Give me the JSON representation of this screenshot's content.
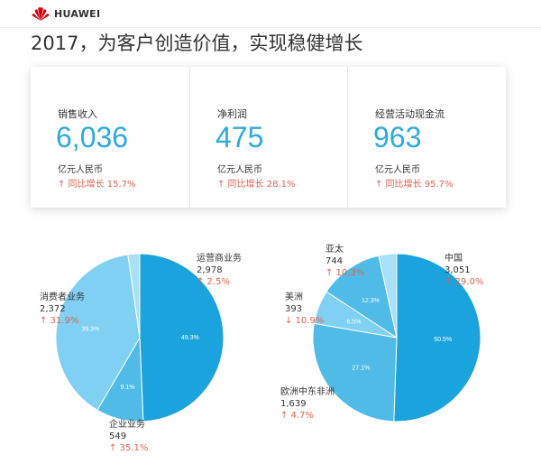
{
  "header": {
    "brand": "HUAWEI",
    "headline": "2017，为客户创造价值，实现稳健增长"
  },
  "kpis": [
    {
      "label": "销售收入",
      "value": "6,036",
      "unit": "亿元人民币",
      "change": "↑ 同比增长 15.7%"
    },
    {
      "label": "净利润",
      "value": "475",
      "unit": "亿元人民币",
      "change": "↑ 同比增长 28.1%"
    },
    {
      "label": "经营活动现金流",
      "value": "963",
      "unit": "亿元人民币",
      "change": "↑ 同比增长 95.7%"
    }
  ],
  "colors": {
    "accent": "#2eaadc",
    "up": "#e2604f",
    "pie_dark": "#1aa3dc",
    "pie_mid": "#4fbbe6",
    "pie_light": "#7fd0f2",
    "pie_lighter": "#a8e0f7"
  },
  "chart_data": [
    {
      "type": "pie",
      "title": "",
      "slices": [
        {
          "name": "运营商业务",
          "value": 2978,
          "percent": 49.3,
          "label": "49.3%",
          "change": "↑ 2.5%"
        },
        {
          "name": "企业业务",
          "value": 549,
          "percent": 9.1,
          "label": "9.1%",
          "change": "↑ 35.1%"
        },
        {
          "name": "消费者业务",
          "value": 2372,
          "percent": 39.3,
          "label": "39.3%",
          "change": "↑ 31.9%"
        },
        {
          "name": "",
          "value": 137,
          "percent": 2.3,
          "label": "",
          "change": ""
        }
      ],
      "callouts": [
        {
          "name": "运营商业务",
          "value": "2,978",
          "change": "↑ 2.5%"
        },
        {
          "name": "消费者业务",
          "value": "2,372",
          "change": "↑ 31.9%"
        },
        {
          "name": "企业业务",
          "value": "549",
          "change": "↑ 35.1%"
        }
      ]
    },
    {
      "type": "pie",
      "title": "",
      "slices": [
        {
          "name": "中国",
          "value": 3051,
          "percent": 50.5,
          "label": "50.5%",
          "change": "↑ 29.0%"
        },
        {
          "name": "欧洲中东非洲",
          "value": 1639,
          "percent": 27.1,
          "label": "27.1%",
          "change": "↑ 4.7%"
        },
        {
          "name": "美洲",
          "value": 393,
          "percent": 6.5,
          "label": "6.5%",
          "change": "↓ 10.9%"
        },
        {
          "name": "亚太",
          "value": 744,
          "percent": 12.3,
          "label": "12.3%",
          "change": "↑ 10.3%"
        },
        {
          "name": "",
          "value": 209,
          "percent": 3.6,
          "label": "",
          "change": ""
        }
      ],
      "callouts": [
        {
          "name": "亚太",
          "value": "744",
          "change": "↑ 10.3%"
        },
        {
          "name": "中国",
          "value": "3,051",
          "change": "↑ 29.0%"
        },
        {
          "name": "美洲",
          "value": "393",
          "change": "↓ 10.9%"
        },
        {
          "name": "欧洲中东非洲",
          "value": "1,639",
          "change": "↑ 4.7%"
        }
      ]
    }
  ]
}
